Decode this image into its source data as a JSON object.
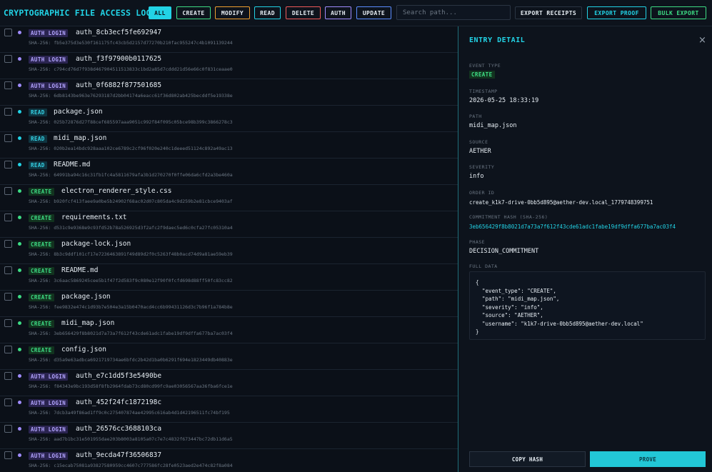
{
  "app": {
    "title": "CRYPTOGRAPHIC FILE ACCESS LOG"
  },
  "filters": [
    {
      "label": "ALL",
      "color": "#22d3e6",
      "active": true
    },
    {
      "label": "CREATE",
      "color": "#3ddc84",
      "active": false
    },
    {
      "label": "MODIFY",
      "color": "#f0a030",
      "active": false
    },
    {
      "label": "READ",
      "color": "#22d3e6",
      "active": false
    },
    {
      "label": "DELETE",
      "color": "#f05a5a",
      "active": false
    },
    {
      "label": "AUTH",
      "color": "#a08cff",
      "active": false
    },
    {
      "label": "UPDATE",
      "color": "#5b8cff",
      "active": false
    }
  ],
  "search": {
    "placeholder": "Search path..."
  },
  "toolbar": {
    "export_receipts": "EXPORT RECEIPTS",
    "export_proof": "EXPORT PROOF",
    "bulk_export": "BULK EXPORT"
  },
  "rows": [
    {
      "type": "auth",
      "tag": "AUTH LOGIN",
      "path": "auth_8cb3ecf5fe692947",
      "hash": "SHA-256: fb5e375d3e530f161175fc43cb5d2157d77270b210fac955247c4b1091139244"
    },
    {
      "type": "auth",
      "tag": "AUTH LOGIN",
      "path": "auth_f3f97900b0117625",
      "hash": "SHA-256: c794cd76d7f938d467904511513833c1bd2a85d7cddd21d56e66c0f831ceaae0"
    },
    {
      "type": "auth",
      "tag": "AUTH LOGIN",
      "path": "auth_0f6882f877501685",
      "hash": "SHA-256: 6db8143be963e76293187d2bb04174a6eacc61f36d802ab425becddf5e19338e"
    },
    {
      "type": "read",
      "tag": "READ",
      "path": "package.json",
      "hash": "SHA-256: 025b72876d27f88cef685597aaa9051c992f84f095c05bce98b399c3866278c3"
    },
    {
      "type": "read",
      "tag": "READ",
      "path": "midi_map.json",
      "hash": "SHA-256: 020b2ea14bdc928aaa102ce6789c2cf96f020e240c1deeed51124c892a49ac13"
    },
    {
      "type": "read",
      "tag": "READ",
      "path": "README.md",
      "hash": "SHA-256: 64991ba94c16c31fb1fc4a5811679afa3b1d270270f0ffe06da6cfd2a3be460a"
    },
    {
      "type": "create",
      "tag": "CREATE",
      "path": "electron_renderer_style.css",
      "hash": "SHA-256: b920fcf413faee9a0be5b24902f68ac02d07c805da4c9d259b2e81cbce9403af"
    },
    {
      "type": "create",
      "tag": "CREATE",
      "path": "requirements.txt",
      "hash": "SHA-256: d531c9e9368e9c93fd52b78a526925d3f2afc2f9daec5ed6c0cfa27fc05310a4"
    },
    {
      "type": "create",
      "tag": "CREATE",
      "path": "package-lock.json",
      "hash": "SHA-256: 8b3c9ddf101cf17e7236463891f49d89d2f0c5263f48b0acd74d9a81ae59eb39"
    },
    {
      "type": "create",
      "tag": "CREATE",
      "path": "README.md",
      "hash": "SHA-256: 3c6aac5869245cee5b1f47f2d583f9c080e12f90f0fcfd698d88ff50fc83cc82"
    },
    {
      "type": "create",
      "tag": "CREATE",
      "path": "package.json",
      "hash": "SHA-256: fee9832e474c1d93b7e504e3a15b0470acd4cc6b99431126d3c7b96f1a784b8e"
    },
    {
      "type": "create",
      "tag": "CREATE",
      "path": "midi_map.json",
      "hash": "SHA-256: 3eb656429f8b8021d7a73a7f612f43cde61adc1fabe19df9dffa677ba7ac03f4"
    },
    {
      "type": "create",
      "tag": "CREATE",
      "path": "config.json",
      "hash": "SHA-256: d35a9e63adbca6921719734ae6bfdc2b42d1ba0b6291f694e1823449db40883e"
    },
    {
      "type": "auth",
      "tag": "AUTH LOGIN",
      "path": "auth_e7c1dd5f3e5490be",
      "hash": "SHA-256: f84343e9bc193d58f8fb2964fdab73cd80cd99fc9ae03056567aa36fba6fce1e"
    },
    {
      "type": "auth",
      "tag": "AUTH LOGIN",
      "path": "auth_452f24fc1872198c",
      "hash": "SHA-256: 7dcb3a49f86ad1ff9c0c275407874ae42995c616ab4d1d42196511fc74bf195"
    },
    {
      "type": "auth",
      "tag": "AUTH LOGIN",
      "path": "auth_26576cc3688103ca",
      "hash": "SHA-256: aad7b1bc31e501955dae203b8003a8105a07c7e7c4832f673447bc72db11d6a5"
    },
    {
      "type": "auth",
      "tag": "AUTH LOGIN",
      "path": "auth_9ecda47f36506837",
      "hash": "SHA-256: c15ecab75081a93827580959cc4607c777586fc28fe0523aed2e474c82f8a084"
    }
  ],
  "type_colors": {
    "auth": "#a08cff",
    "read": "#22d3e6",
    "create": "#3ddc84"
  },
  "detail": {
    "title": "ENTRY DETAIL",
    "close_glyph": "×",
    "event_type_label": "EVENT TYPE",
    "event_type": "CREATE",
    "timestamp_label": "TIMESTAMP",
    "timestamp": "2026-05-25 18:33:19",
    "path_label": "PATH",
    "path": "midi_map.json",
    "source_label": "SOURCE",
    "source": "AETHER",
    "severity_label": "SEVERITY",
    "severity": "info",
    "order_id_label": "ORDER ID",
    "order_id": "create_k1k7-drive-0bb5d895@aether-dev.local_1779748399751",
    "commitment_hash_label": "COMMITMENT HASH (SHA-256)",
    "commitment_hash": "3eb656429f8b8021d7a73a7f612f43cde61adc1fabe19df9dffa677ba7ac03f4",
    "phase_label": "PHASE",
    "phase": "DECISION_COMMITMENT",
    "full_data_label": "FULL DATA",
    "full_data": "{\n  \"event_type\": \"CREATE\",\n  \"path\": \"midi_map.json\",\n  \"severity\": \"info\",\n  \"source\": \"AETHER\",\n  \"username\": \"k1k7-drive-0bb5d895@aether-dev.local\"\n}",
    "copy_hash": "COPY HASH",
    "prove": "PROVE"
  }
}
